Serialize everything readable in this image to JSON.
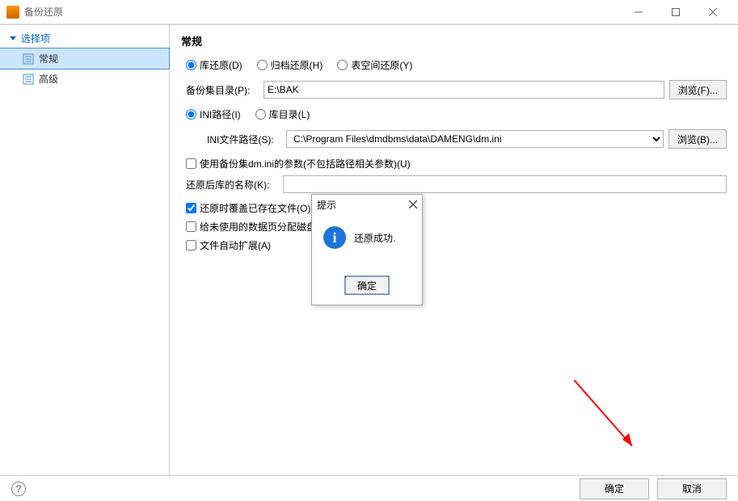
{
  "window": {
    "title": "备份还原"
  },
  "sidebar": {
    "header": "选择项",
    "items": [
      {
        "label": "常规"
      },
      {
        "label": "高级"
      }
    ]
  },
  "main": {
    "section_title": "常规",
    "restore_type": {
      "db": "库还原(D)",
      "archive": "归档还原(H)",
      "tablespace": "表空间还原(Y)"
    },
    "bak_dir_label": "备份集目录(P):",
    "bak_dir_value": "E:\\BAK",
    "browse_f": "浏览(F)...",
    "path_mode": {
      "ini": "INI路径(I)",
      "dbdir": "库目录(L)"
    },
    "ini_path_label": "INI文件路径(S):",
    "ini_path_value": "C:\\Program Files\\dmdbms\\data\\DAMENG\\dm.ini",
    "browse_b": "浏览(B)...",
    "chk_use_bak_params": "使用备份集dm.ini的参数(不包括路径相关参数)(U)",
    "restored_name_label": "还原后库的名称(K):",
    "restored_name_value": "",
    "chk_overwrite": "还原时覆盖已存在文件(O)",
    "chk_alloc_disk": "给未使用的数据页分配磁盘",
    "chk_auto_expand": "文件自动扩展(A)"
  },
  "dialog": {
    "title": "提示",
    "message": "还原成功.",
    "ok": "确定"
  },
  "footer": {
    "ok": "确定",
    "cancel": "取消"
  }
}
